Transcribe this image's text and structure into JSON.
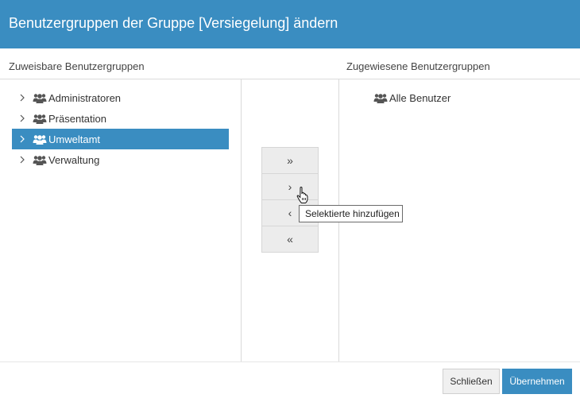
{
  "dialog": {
    "title": "Benutzergruppen der Gruppe [Versiegelung] ändern"
  },
  "left_panel": {
    "header": "Zuweisbare Benutzergruppen",
    "items": [
      {
        "label": "Administratoren",
        "selected": false
      },
      {
        "label": "Präsentation",
        "selected": false
      },
      {
        "label": "Umweltamt",
        "selected": true
      },
      {
        "label": "Verwaltung",
        "selected": false
      }
    ]
  },
  "right_panel": {
    "header": "Zugewiesene Benutzergruppen",
    "items": [
      {
        "label": "Alle Benutzer"
      }
    ]
  },
  "move_buttons": {
    "add_all": "»",
    "add_selected": "›",
    "remove_selected": "‹",
    "remove_all": "«"
  },
  "tooltip": {
    "text": "Selektierte hinzufügen"
  },
  "footer": {
    "close_label": "Schließen",
    "apply_label": "Übernehmen"
  },
  "icons": {
    "expand": "chevron-right-icon",
    "group": "users-group-icon",
    "cursor": "hand-pointer-icon"
  },
  "colors": {
    "accent": "#3a8dc1",
    "selected_bg": "#3a8dc1",
    "button_bg": "#ececec"
  }
}
